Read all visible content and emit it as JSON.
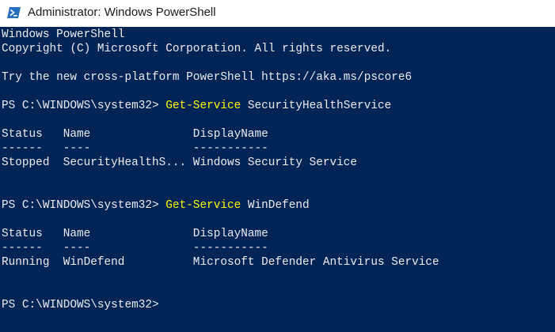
{
  "window": {
    "title": "Administrator: Windows PowerShell",
    "icon": "powershell-icon"
  },
  "colors": {
    "console_background": "#012456",
    "console_text": "#eeedf0",
    "command_text": "#ffff00"
  },
  "console": {
    "banner": "Windows PowerShell",
    "copyright": "Copyright (C) Microsoft Corporation. All rights reserved.",
    "tip": "Try the new cross-platform PowerShell https://aka.ms/pscore6",
    "commands": [
      {
        "prompt": "PS C:\\WINDOWS\\system32> ",
        "cmdlet": "Get-Service",
        "argument": " SecurityHealthService",
        "header": "Status   Name               DisplayName",
        "underline": "------   ----               -----------",
        "row": "Stopped  SecurityHealthS... Windows Security Service"
      },
      {
        "prompt": "PS C:\\WINDOWS\\system32> ",
        "cmdlet": "Get-Service",
        "argument": " WinDefend",
        "header": "Status   Name               DisplayName",
        "underline": "------   ----               -----------",
        "row": "Running  WinDefend          Microsoft Defender Antivirus Service"
      }
    ],
    "final_prompt": "PS C:\\WINDOWS\\system32>"
  }
}
